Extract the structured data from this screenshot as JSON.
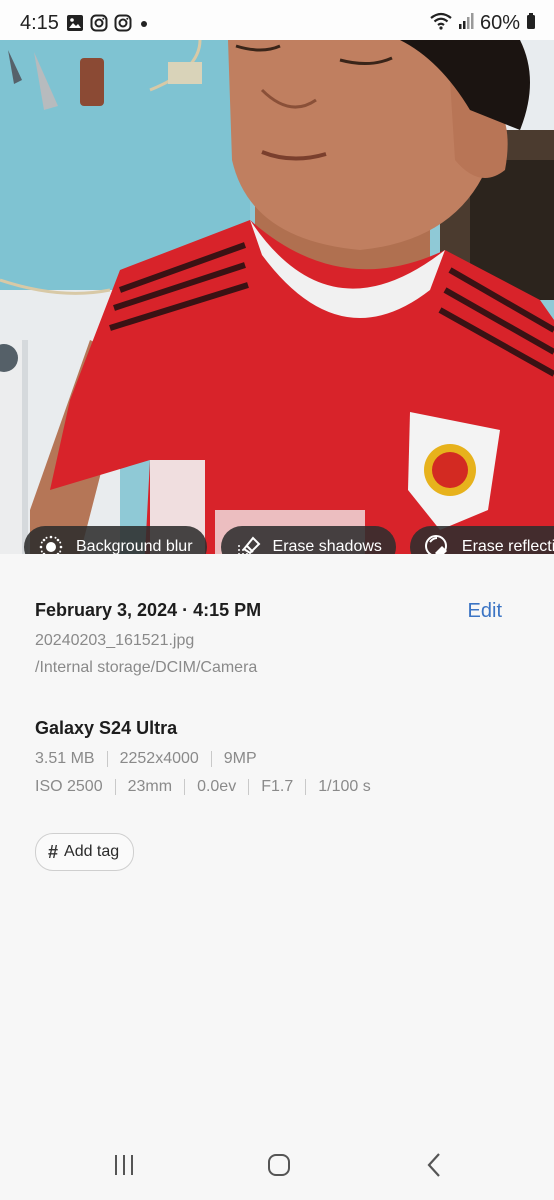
{
  "status_bar": {
    "time": "4:15",
    "battery": "60%",
    "notification_icons": [
      "gallery-icon",
      "instagram-icon",
      "instagram-icon",
      "dot-icon"
    ]
  },
  "photo_actions": {
    "background_blur": "Background blur",
    "erase_shadows": "Erase shadows",
    "erase_reflections": "Erase reflections"
  },
  "details": {
    "date_time": "February 3, 2024 · 4:15 PM",
    "edit_label": "Edit",
    "filename": "20240203_161521.jpg",
    "path": "/Internal storage/DCIM/Camera",
    "device": "Galaxy S24 Ultra",
    "size": "3.51 MB",
    "resolution": "2252x4000",
    "megapixels": "9MP",
    "iso": "ISO 2500",
    "focal_length": "23mm",
    "exposure_value": "0.0ev",
    "aperture": "F1.7",
    "shutter": "1/100 s",
    "add_tag_label": "Add tag"
  },
  "colors": {
    "accent": "#3b74c4",
    "chip_bg": "#2d2d2d",
    "panel_bg": "#f7f7f7"
  }
}
